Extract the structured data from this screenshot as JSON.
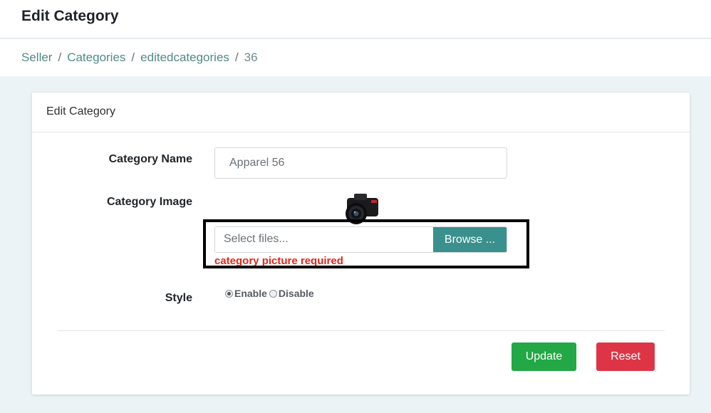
{
  "header": {
    "title": "Edit Category"
  },
  "breadcrumb": [
    "Seller",
    "Categories",
    "editedcategories",
    "36"
  ],
  "card": {
    "title": "Edit Category",
    "fields": {
      "category_name": {
        "label": "Category Name",
        "value": "Apparel 56"
      },
      "category_image": {
        "label": "Category Image",
        "file_placeholder": "Select files...",
        "browse_label": "Browse ...",
        "error": "category picture required"
      },
      "style": {
        "label": "Style",
        "options": [
          {
            "label": "Enable",
            "checked": true
          },
          {
            "label": "Disable",
            "checked": false
          }
        ]
      }
    },
    "buttons": {
      "update": "Update",
      "reset": "Reset"
    }
  },
  "colors": {
    "accent": "#3a908d",
    "update": "#22a845",
    "reset": "#dd3545",
    "error": "#e0271b"
  }
}
